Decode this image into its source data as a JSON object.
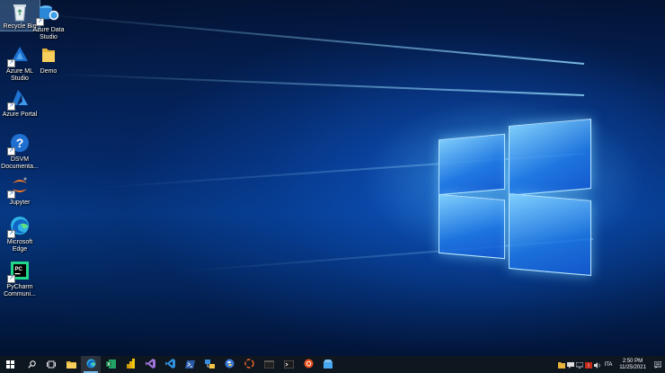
{
  "desktop": {
    "icons": [
      {
        "label": "Recycle Bin",
        "icon": "recycle-bin-icon"
      },
      {
        "label": "Azure Data\nStudio",
        "icon": "azure-data-studio-icon"
      },
      {
        "label": "Azure ML\nStudio",
        "icon": "azure-ml-studio-icon"
      },
      {
        "label": "Demo",
        "icon": "folder-icon"
      },
      {
        "label": "Azure Portal",
        "icon": "azure-portal-icon"
      },
      {
        "label": "DSVM\nDocumenta...",
        "icon": "help-icon"
      },
      {
        "label": "Jupyter",
        "icon": "jupyter-icon"
      },
      {
        "label": "Microsoft\nEdge",
        "icon": "edge-icon"
      },
      {
        "label": "PyCharm\nCommuni...",
        "icon": "pycharm-icon"
      }
    ]
  },
  "taskbar": {
    "apps": [
      "start-icon",
      "search-icon",
      "task-view-icon",
      "file-explorer-icon",
      "edge-icon",
      "excel-icon",
      "power-bi-icon",
      "visual-studio-icon",
      "vscode-icon",
      "powershell-icon",
      "network-icon",
      "python-icon",
      "r-icon",
      "jupyter-icon",
      "terminal-icon",
      "ubuntu-icon",
      "azure-storage-explorer-icon"
    ],
    "tray": {
      "language": "ITA",
      "time": "2:50 PM",
      "date": "11/25/2021"
    }
  },
  "colors": {
    "accent": "#0078d4",
    "taskbar": "#0e1620"
  }
}
